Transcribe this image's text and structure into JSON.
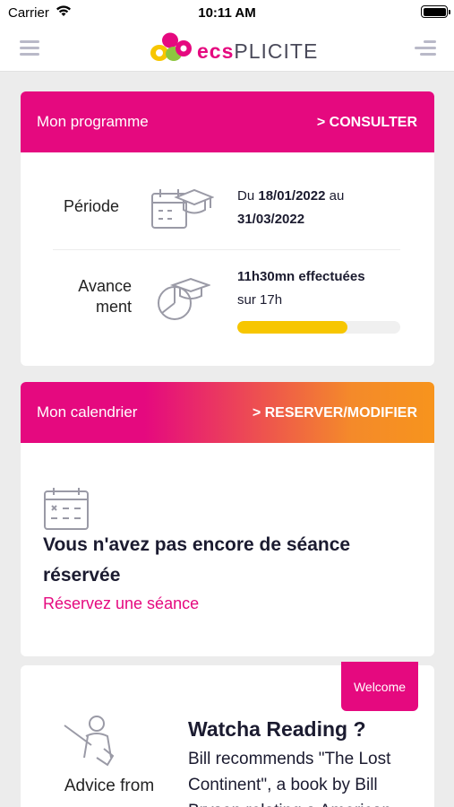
{
  "status_bar": {
    "carrier": "Carrier",
    "time": "10:11 AM"
  },
  "app": {
    "logo_left": "ecs",
    "logo_right": "PLICITE",
    "brand_color": "#e5097f"
  },
  "program": {
    "title": "Mon programme",
    "link": "> CONSULTER",
    "period_label": "Période",
    "period_prefix": "Du",
    "period_start": "18/01/2022",
    "period_mid": "au",
    "period_end": "31/03/2022",
    "progress_label_line1": "Avance",
    "progress_label_line2": "ment",
    "hours_done": "11h30mn effectuées",
    "hours_total": "sur 17h",
    "progress_fraction": 0.676
  },
  "calendar": {
    "title": "Mon calendrier",
    "link": "> RESERVER/MODIFIER",
    "empty_title": "Vous n'avez pas encore de séance réservée",
    "empty_link": "Réservez une séance"
  },
  "promo": {
    "badge": "Welcome",
    "caption": "Advice from",
    "title": "Watcha Reading ?",
    "body": "Bill recommends \"The Lost Continent\", a book by Bill Bryson relating a American"
  }
}
